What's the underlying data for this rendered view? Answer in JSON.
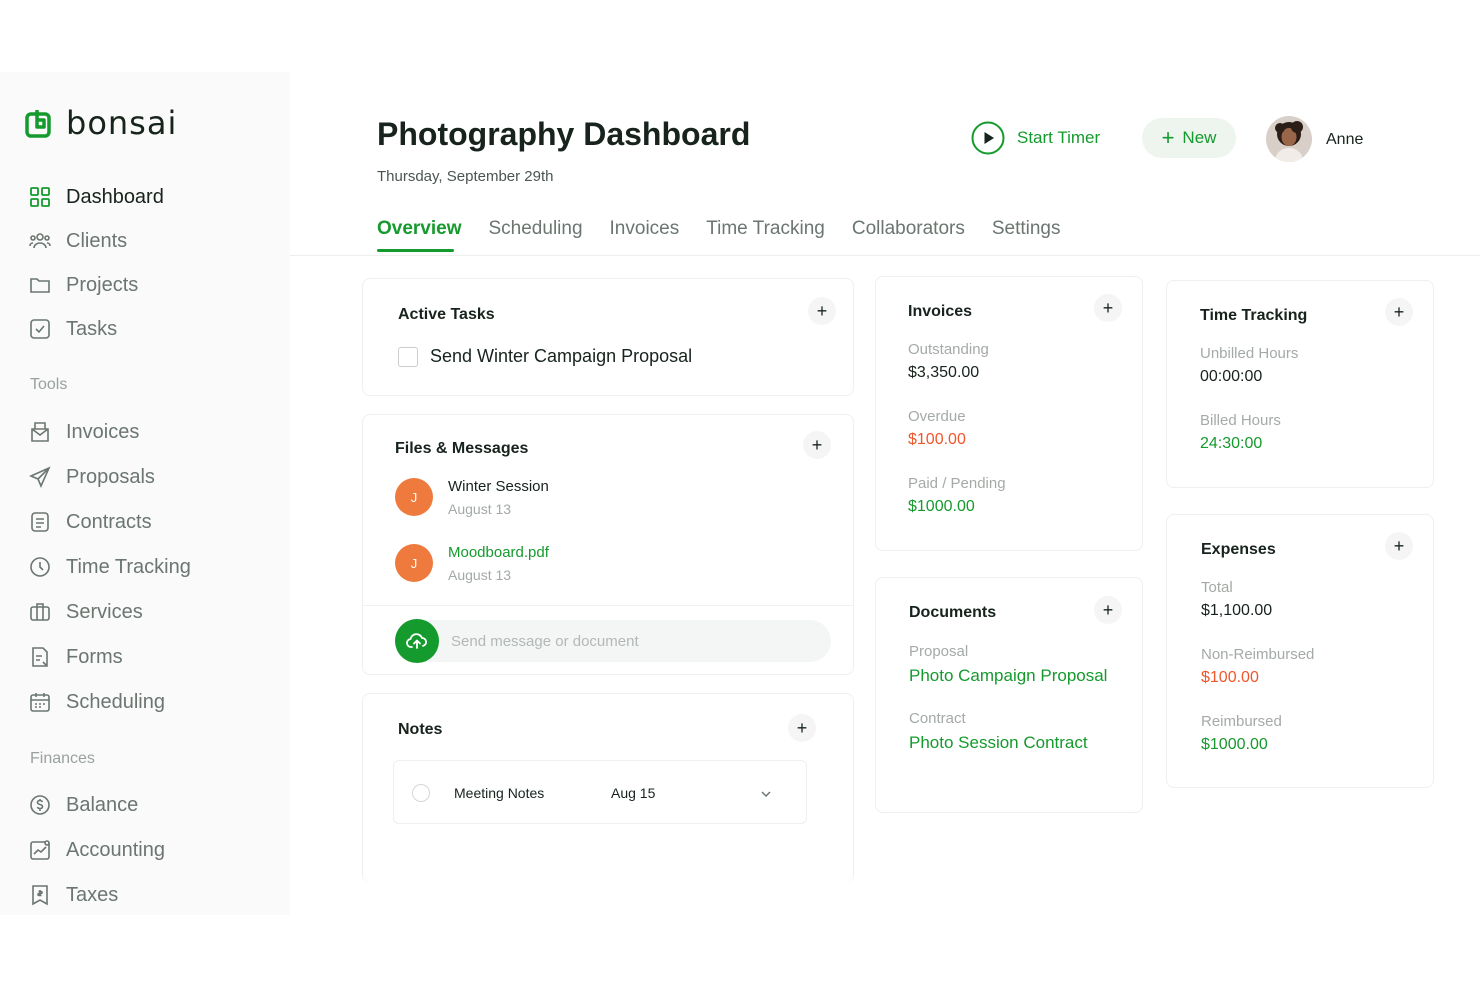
{
  "brand": {
    "name": "bonsai",
    "color": "#159a2d"
  },
  "sidebar": {
    "main": [
      {
        "label": "Dashboard",
        "icon": "grid-icon",
        "active": true
      },
      {
        "label": "Clients",
        "icon": "users-icon"
      },
      {
        "label": "Projects",
        "icon": "folder-icon"
      },
      {
        "label": "Tasks",
        "icon": "checkbox-icon"
      }
    ],
    "tools_heading": "Tools",
    "tools": [
      {
        "label": "Invoices",
        "icon": "invoice-icon"
      },
      {
        "label": "Proposals",
        "icon": "send-icon"
      },
      {
        "label": "Contracts",
        "icon": "document-icon"
      },
      {
        "label": "Time Tracking",
        "icon": "clock-icon"
      },
      {
        "label": "Services",
        "icon": "briefcase-icon"
      },
      {
        "label": "Forms",
        "icon": "form-icon"
      },
      {
        "label": "Scheduling",
        "icon": "calendar-icon"
      }
    ],
    "finances_heading": "Finances",
    "finances": [
      {
        "label": "Balance",
        "icon": "dollar-circle-icon"
      },
      {
        "label": "Accounting",
        "icon": "chart-icon"
      },
      {
        "label": "Taxes",
        "icon": "receipt-icon"
      }
    ]
  },
  "header": {
    "title": "Photography Dashboard",
    "date": "Thursday, September 29th",
    "start_timer": "Start Timer",
    "new_button": "New",
    "user_name": "Anne"
  },
  "tabs": [
    "Overview",
    "Scheduling",
    "Invoices",
    "Time Tracking",
    "Collaborators",
    "Settings"
  ],
  "active_tasks": {
    "title": "Active Tasks",
    "tasks": [
      "Send Winter Campaign Proposal"
    ]
  },
  "files": {
    "title": "Files & Messages",
    "items": [
      {
        "initial": "J",
        "title": "Winter Session",
        "date": "August 13",
        "is_link": false
      },
      {
        "initial": "J",
        "title": "Moodboard.pdf",
        "date": "August 13",
        "is_link": true
      }
    ],
    "input_placeholder": "Send message or document"
  },
  "notes": {
    "title": "Notes",
    "items": [
      {
        "title": "Meeting Notes",
        "date": "Aug 15"
      }
    ]
  },
  "invoices": {
    "title": "Invoices",
    "outstanding_label": "Outstanding",
    "outstanding_value": "$3,350.00",
    "overdue_label": "Overdue",
    "overdue_value": "$100.00",
    "paid_label": "Paid / Pending",
    "paid_value": "$1000.00"
  },
  "documents": {
    "title": "Documents",
    "proposal_label": "Proposal",
    "proposal_value": "Photo Campaign Proposal",
    "contract_label": "Contract",
    "contract_value": "Photo Session Contract"
  },
  "time_tracking": {
    "title": "Time Tracking",
    "unbilled_label": "Unbilled Hours",
    "unbilled_value": "00:00:00",
    "billed_label": "Billed Hours",
    "billed_value": "24:30:00"
  },
  "expenses": {
    "title": "Expenses",
    "total_label": "Total",
    "total_value": "$1,100.00",
    "nonreimb_label": "Non-Reimbursed",
    "nonreimb_value": "$100.00",
    "reimb_label": "Reimbursed",
    "reimb_value": "$1000.00"
  },
  "plus_glyph": "+"
}
